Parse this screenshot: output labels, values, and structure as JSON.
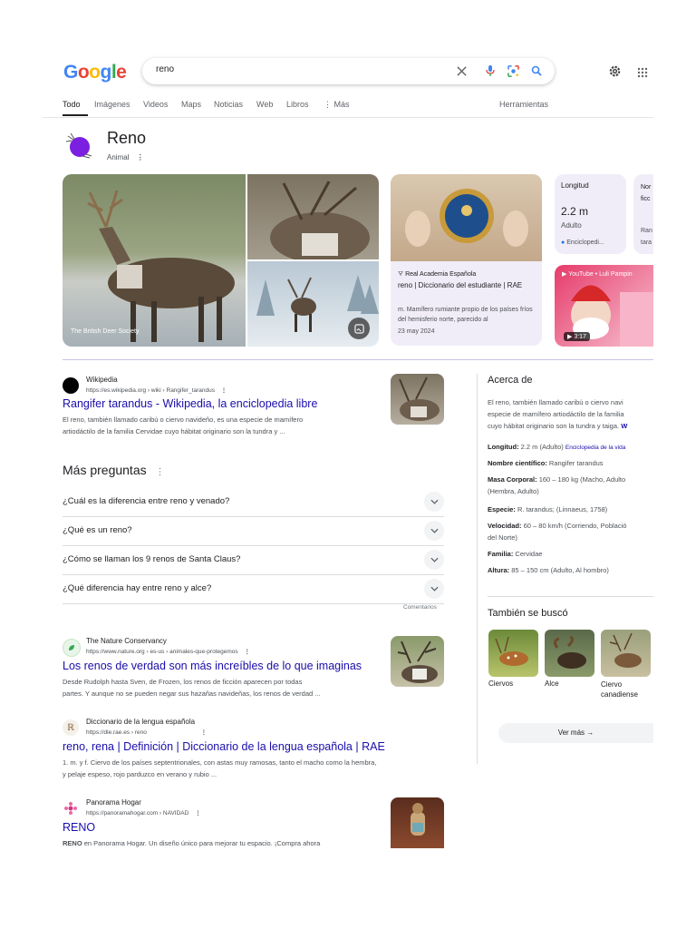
{
  "header": {
    "logo_text": "Google",
    "search_query": "reno"
  },
  "tabs": [
    "Todo",
    "Imágenes",
    "Videos",
    "Maps",
    "Noticias",
    "Web",
    "Libros",
    "Más"
  ],
  "tools_label": "Herramientas",
  "knowledge_panel": {
    "title": "Reno",
    "subtitle": "Animal",
    "image_credit": "The British Deer Society",
    "rae_card": {
      "source": "Real Academia Española",
      "title": "reno | Diccionario del estudiante | RAE",
      "snippet": "m. Mamífero rumiante propio de los países fríos del hemisferio norte, parecido al",
      "date": "23 may 2024"
    },
    "length_card": {
      "label": "Longitud",
      "value": "2.2 m",
      "qualifier": "Adulto",
      "source": "Enciclopedi..."
    },
    "partial_card": {
      "label": "Nor ficc",
      "line2": "Ran tara"
    },
    "video_card": {
      "source": "YouTube • Luli Pampin",
      "duration": "3:17"
    }
  },
  "results": [
    {
      "source": "Wikipedia",
      "url": "https://es.wikipedia.org › wiki › Rangifer_tarandus",
      "title": "Rangifer tarandus - Wikipedia, la enciclopedia libre",
      "snippet1": "El reno, también llamado caribú o ciervo navideño, es una especie de mamífero",
      "snippet2": "artiodáctilo de la familia Cervidae cuyo hábitat originario son la tundra y ..."
    },
    {
      "source": "The Nature Conservancy",
      "url": "https://www.nature.org › es-us › animales-que-protegemos",
      "title": "Los renos de verdad son más increíbles de lo que imaginas",
      "snippet1": "Desde Rudolph hasta Sven, de Frozen, los renos de ficción aparecen por todas",
      "snippet2": "partes. Y aunque no se pueden negar sus hazañas navideñas, los renos de verdad ..."
    },
    {
      "source": "Diccionario de la lengua española",
      "url": "https://dle.rae.es › reno",
      "title": "reno, rena | Definición | Diccionario de la lengua española | RAE",
      "snippet1": "1. m. y f. Ciervo de los países septentrionales, con astas muy ramosas, tanto el macho como la hembra,",
      "snippet2": "y pelaje espeso, rojo parduzco en verano y rubio ..."
    },
    {
      "source": "Panorama Hogar",
      "url": "https://panoramahogar.com › NAVIDAD",
      "title": "RENO",
      "snippet_bold": "RENO",
      "snippet1": " en Panorama Hogar. Un diseño único para mejorar tu espacio. ¡Compra ahora"
    }
  ],
  "paa": {
    "heading": "Más preguntas",
    "questions": [
      "¿Cuál es la diferencia entre reno y venado?",
      "¿Qué es un reno?",
      "¿Cómo se llaman los 9 renos de Santa Claus?",
      "¿Qué diferencia hay entre reno y alce?"
    ],
    "feedback": "Comentarios"
  },
  "about": {
    "heading": "Acerca de",
    "desc1": "El reno, también llamado caribú o ciervo navi",
    "desc2": "especie de mamífero artiodáctilo de la familia",
    "desc3": "cuyo hábitat originario son la tundra y taiga.",
    "desc3_link": "W",
    "facts": [
      {
        "label": "Longitud:",
        "value": " 2.2 m (Adulto) ",
        "link": "Enciclopedia de la vida"
      },
      {
        "label": "Nombre científico:",
        "value": " Rangifer tarandus"
      },
      {
        "label": "Masa Corporal:",
        "value": " 160 – 180 kg (Macho, Adulto",
        "cont": "(Hembra, Adulto)"
      },
      {
        "label": "Especie:",
        "value": " R. tarandus; (Linnaeus, 1758)"
      },
      {
        "label": "Velocidad:",
        "value": " 60 – 80 km/h (Corriendo, Població",
        "cont": "del Norte)"
      },
      {
        "label": "Familia:",
        "value": " Cervidae"
      },
      {
        "label": "Altura:",
        "value": " 85 – 150 cm (Adulto, Al hombro)"
      }
    ]
  },
  "also_searched": {
    "heading": "También se buscó",
    "items": [
      "Ciervos",
      "Alce",
      "Ciervo canadiense"
    ],
    "more": "Ver más"
  }
}
